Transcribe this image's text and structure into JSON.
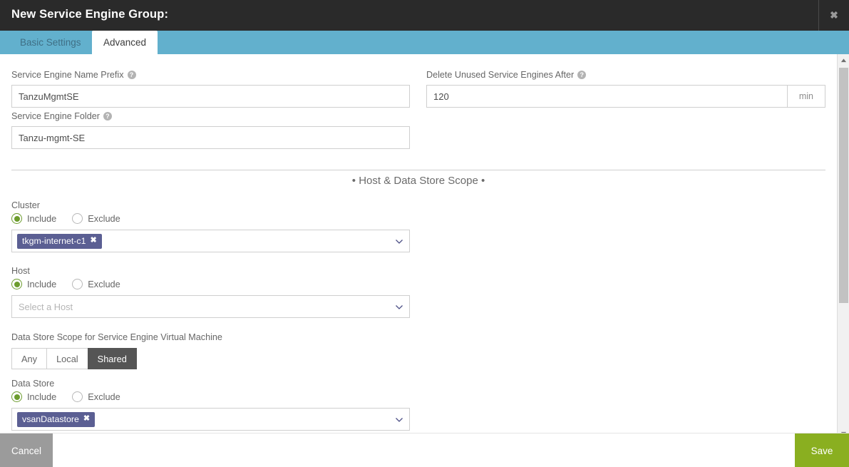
{
  "window": {
    "title": "New Service Engine Group:",
    "close_icon": "close-icon"
  },
  "tabs": [
    {
      "label": "Basic Settings",
      "active": false
    },
    {
      "label": "Advanced",
      "active": true
    }
  ],
  "form": {
    "se_name_prefix": {
      "label": "Service Engine Name Prefix",
      "value": "TanzuMgmtSE",
      "help_icon": "help-icon"
    },
    "se_folder": {
      "label": "Service Engine Folder",
      "value": "Tanzu-mgmt-SE",
      "help_icon": "help-icon"
    },
    "delete_unused": {
      "label": "Delete Unused Service Engines After",
      "value": "120",
      "suffix": "min",
      "help_icon": "help-icon"
    }
  },
  "section": {
    "title": "• Host & Data Store Scope •"
  },
  "cluster": {
    "label": "Cluster",
    "include_label": "Include",
    "exclude_label": "Exclude",
    "selected_mode": "Include",
    "chips": [
      "tkgm-internet-c1"
    ],
    "chip_remove_icon": "✖",
    "caret_icon": "chevron-down-icon"
  },
  "host": {
    "label": "Host",
    "include_label": "Include",
    "exclude_label": "Exclude",
    "selected_mode": "Include",
    "placeholder": "Select a Host",
    "caret_icon": "chevron-down-icon"
  },
  "datastore_scope": {
    "label": "Data Store Scope for Service Engine Virtual Machine",
    "options": [
      "Any",
      "Local",
      "Shared"
    ],
    "selected": "Shared"
  },
  "datastore": {
    "label": "Data Store",
    "include_label": "Include",
    "exclude_label": "Exclude",
    "selected_mode": "Include",
    "chips": [
      "vsanDatastore"
    ],
    "chip_remove_icon": "✖",
    "caret_icon": "chevron-down-icon"
  },
  "footer": {
    "cancel_label": "Cancel",
    "save_label": "Save"
  },
  "colors": {
    "header_bg": "#2a2a2a",
    "tabstrip_bg": "#62b0cd",
    "accent_green": "#6c9c2d",
    "save_green": "#8aaf20",
    "chip_purple": "#5b5f93",
    "segment_selected": "#555555"
  }
}
